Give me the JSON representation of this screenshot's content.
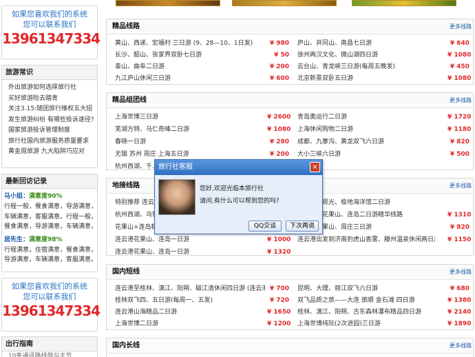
{
  "contact_top": {
    "line1": "如果您喜欢我们的系统",
    "line2": "您可以联系我们",
    "phone": "13961347334"
  },
  "contact_bottom": {
    "line1": "如果您喜欢我们的系统",
    "line2": "您可以联系我们",
    "phone": "13961347334"
  },
  "tips": {
    "title": "旅游常识",
    "items": [
      "外出旅游如何选择旅行社",
      "买好旅游险去踏青",
      "关注3.15:随团旅行维权五大招",
      "发生旅游纠纷 有哪些投诉途径?",
      "国家旅游投诉管理制度",
      "旅行社国内旅游服务质量要求",
      "黄金周旅游 九大陷阱巧应对"
    ]
  },
  "reviews": {
    "title": "最新回访记录",
    "entries": [
      {
        "name": "马小姐：",
        "rating": "满意度90%",
        "lines": [
          "行程一般，餐食满意，导游满意，",
          "车辆满意，客服满意。行程一般，",
          "餐食满意，导游满意，车辆满意，"
        ]
      },
      {
        "name": "居先生：",
        "rating": "满意度98%",
        "lines": [
          "行程满意，住宿满意，餐食满意，",
          "导游满意，车辆满意，客服满意。"
        ]
      }
    ]
  },
  "guide": {
    "title": "出行指南",
    "partial": "10条通讯路线简与主节"
  },
  "more_label": "更多线路",
  "sections": [
    {
      "title": "精品线路",
      "left": [
        [
          "黄山、西递、宏福村 三日游 (9、28—10、1日发)",
          "¥ 980"
        ],
        [
          "长沙、韶山、张家界双卧七日游",
          "¥ 50"
        ],
        [
          "泰山、曲阜二日游",
          "¥ 200"
        ],
        [
          "九江庐山休闲三日游",
          "¥ 600"
        ]
      ],
      "right": [
        [
          "庐山、井冈山、南昌七日游",
          "¥ 640"
        ],
        [
          "徐州两汉文化、微山湖四日游",
          "¥ 1080"
        ],
        [
          "云台山、青龙峡三日游(每周五晚发)",
          "¥ 450"
        ],
        [
          "北京新景双卧五日游",
          "¥ 1080"
        ]
      ]
    },
    {
      "title": "精品组团线",
      "left": [
        [
          "上海世博三日游",
          "¥ 2600"
        ],
        [
          "芜湖方特、马仁奇峰二日游",
          "¥ 1080"
        ],
        [
          "春晓一日游",
          "¥ 280"
        ],
        [
          "无锡 苏州 周庄 上海五日游",
          "¥ 200"
        ],
        [
          "杭州西湖、千…",
          ""
        ]
      ],
      "right": [
        [
          "青岛奥运行二日游",
          "¥ 1720"
        ],
        [
          "上海休闲购物二日游",
          "¥ 1180"
        ],
        [
          "成都、九寨沟、黄龙双飞六日游",
          "¥ 820"
        ],
        [
          "大小三峡六日游",
          "¥ 500"
        ]
      ]
    },
    {
      "title": "地接线路",
      "left": [
        [
          "特别推荐 连云…",
          ""
        ],
        [
          "杭州西湖、乌镇…",
          ""
        ],
        [
          "花果山+连岛精…",
          ""
        ],
        [
          "连云港花果山、连岛一日游",
          "¥ 1000"
        ],
        [
          "连云港花果山、连岛一日游",
          "¥ 1320"
        ]
      ],
      "right": [
        [
          "青岛海滨观光、极地海洋馆二日游",
          ""
        ],
        [
          "连云港、花果山、连岛二日游精华线路",
          "¥ 1310"
        ],
        [
          "连云港花果山、周庄三日游",
          "¥ 820"
        ],
        [
          "连云港出发到济南豹虎山香雾、滕州温泉休闲两日游",
          "¥ 1150"
        ]
      ]
    },
    {
      "title": "国内短线",
      "left": [
        [
          "连云港至桂林、漓江、阳朔、磁江清休闲四日游 (连云港",
          "¥ 700"
        ],
        [
          "桂林双飞四、五日游(每周一、五发)",
          "¥ 720"
        ],
        [
          "连云港山海精品二日游",
          "¥ 1650"
        ],
        [
          "上海世博二日游",
          "¥ 1200"
        ]
      ],
      "right": [
        [
          "昆明、大理、丽江双飞六日游",
          "¥ 680"
        ],
        [
          "双飞品质之旅——大连 旅顺 金石滩 四日游",
          "¥ 1380"
        ],
        [
          "桂林、漓江、阳朔、古东森林瀑布精品四日游",
          "¥ 2140"
        ],
        [
          "上海世博纯玩(2次进园)三日游",
          "¥ 1890"
        ]
      ]
    },
    {
      "title": "国内长线",
      "left": [],
      "right": []
    }
  ],
  "dialog": {
    "title": "旅行社客服",
    "close": "×",
    "msg1": "您好,欢迎光临本旅行社",
    "msg2": "请问,有什么可以帮到您的吗?",
    "btn_qq": "QQ交谈",
    "btn_later": "下次再说"
  }
}
